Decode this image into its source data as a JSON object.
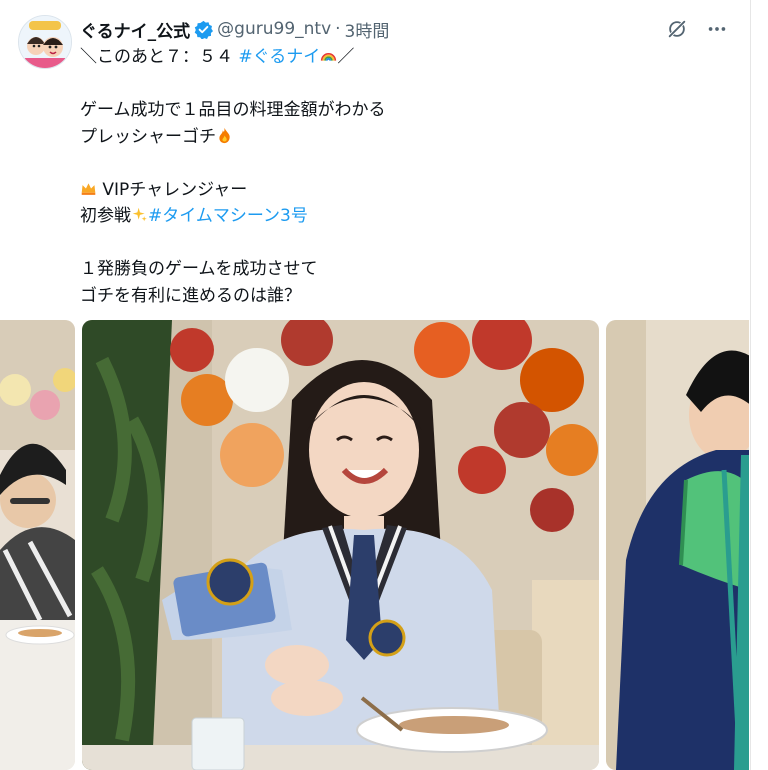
{
  "tweet": {
    "display_name": "ぐるナイ_公式",
    "handle": "@guru99_ntv",
    "separator": "·",
    "time": "3時間",
    "lines": [
      "＼このあと７：５４",
      "ゲーム成功で１品目の料理金額がわかる",
      "プレッシャーゴチ",
      "VIPチャレンジャー",
      "初参戦",
      "１発勝負のゲームを成功させて",
      "ゴチを有利に進めるのは誰？"
    ],
    "hashtag_1": "#ぐるナイ",
    "line0_tail": "／",
    "hashtag_2": "#タイムマシーン3号"
  },
  "icons": {
    "avatar": "avatar-image",
    "verified": "verified-badge-icon",
    "grok": "grok-icon",
    "more": "more-icon",
    "rainbow": "rainbow-emoji",
    "fire": "fire-emoji",
    "crown": "crown-emoji",
    "sparkles": "sparkles-emoji"
  },
  "colors": {
    "link": "#1d9bf0",
    "secondary_text": "#536471",
    "verified": "#1d9bf0"
  },
  "media": {
    "count": 3
  }
}
